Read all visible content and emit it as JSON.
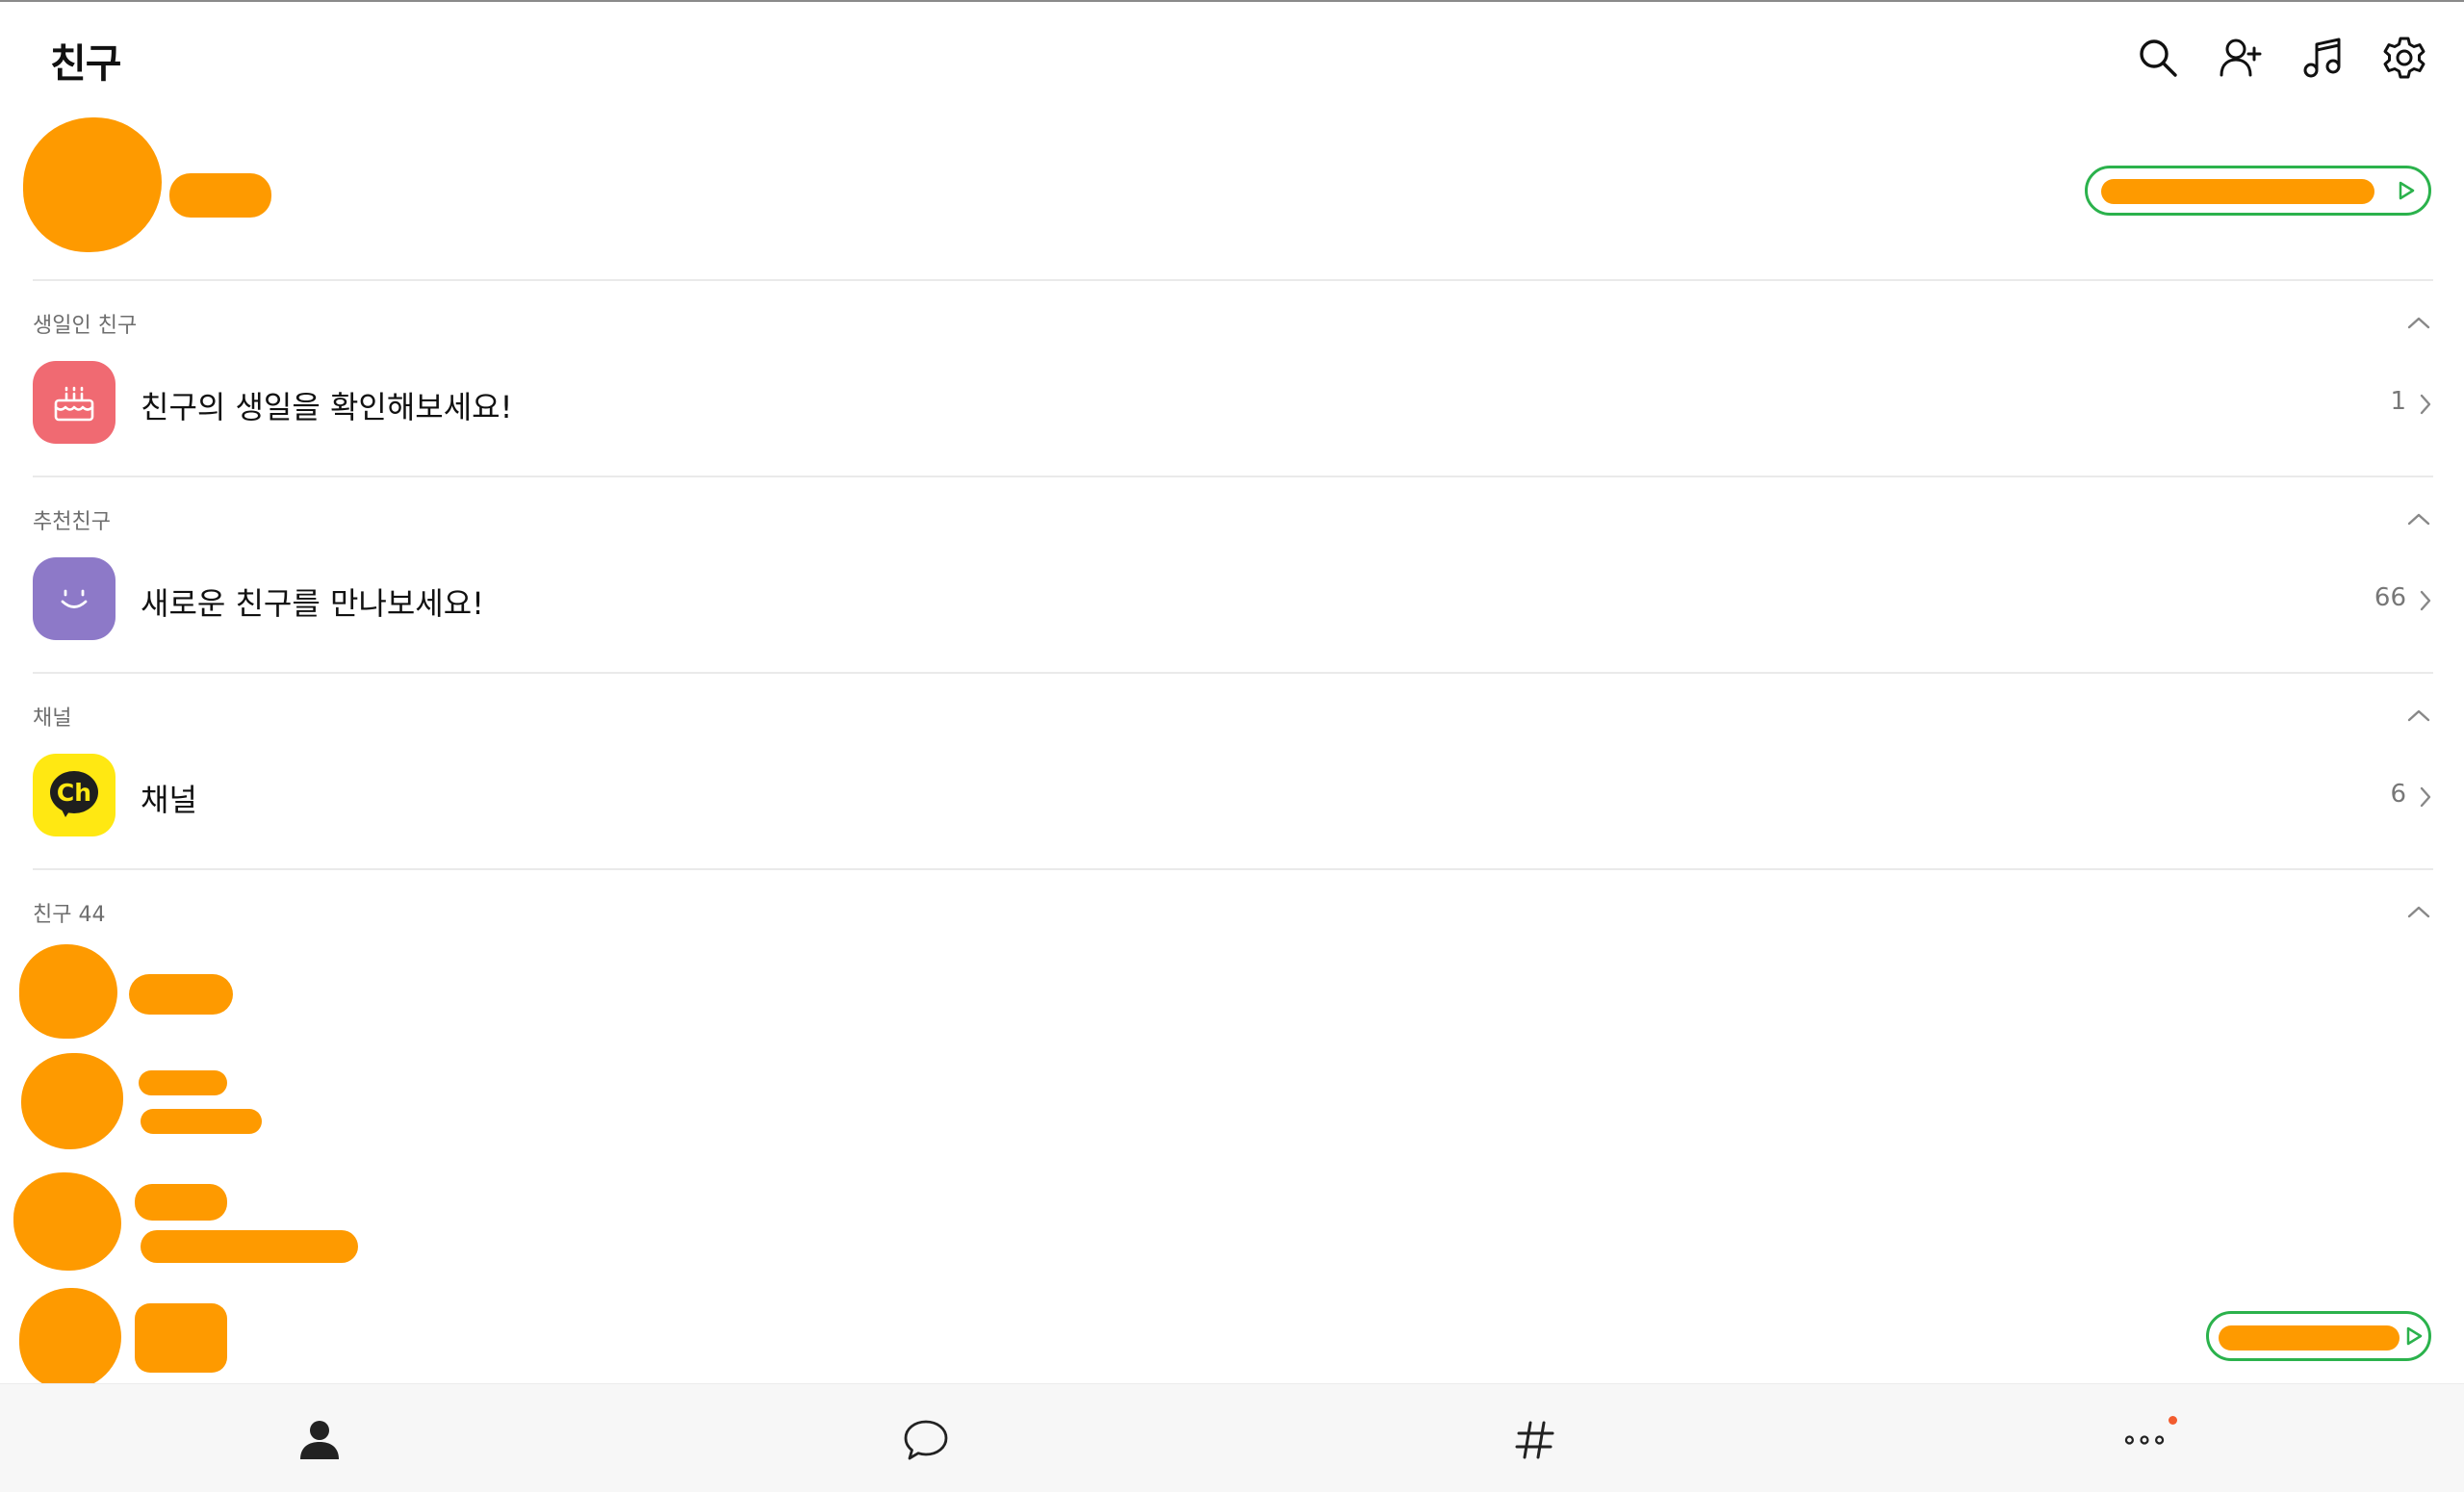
{
  "header": {
    "title": "친구",
    "icons": [
      "search-icon",
      "add-friend-icon",
      "music-icon",
      "settings-icon"
    ]
  },
  "sections": {
    "birthday": {
      "label": "생일인 친구",
      "row_text": "친구의 생일을 확인해보세요!",
      "count": "1"
    },
    "recommended": {
      "label": "추천친구",
      "row_text": "새로운 친구를 만나보세요!",
      "count": "66"
    },
    "channel": {
      "label": "채널",
      "row_text": "채널",
      "count": "6",
      "badge_text": "Ch"
    },
    "friends": {
      "label": "친구 44"
    }
  },
  "bottom_nav": {
    "tabs": [
      "friends-tab",
      "chats-tab",
      "openchat-tab",
      "more-tab"
    ]
  },
  "colors": {
    "accent_green": "#2bb24c",
    "birthday_icon_bg": "#f06a72",
    "recommend_icon_bg": "#8d79c8",
    "channel_icon_bg": "#ffe812",
    "redaction": "#fe9a00",
    "notification_dot": "#f25c2f"
  }
}
